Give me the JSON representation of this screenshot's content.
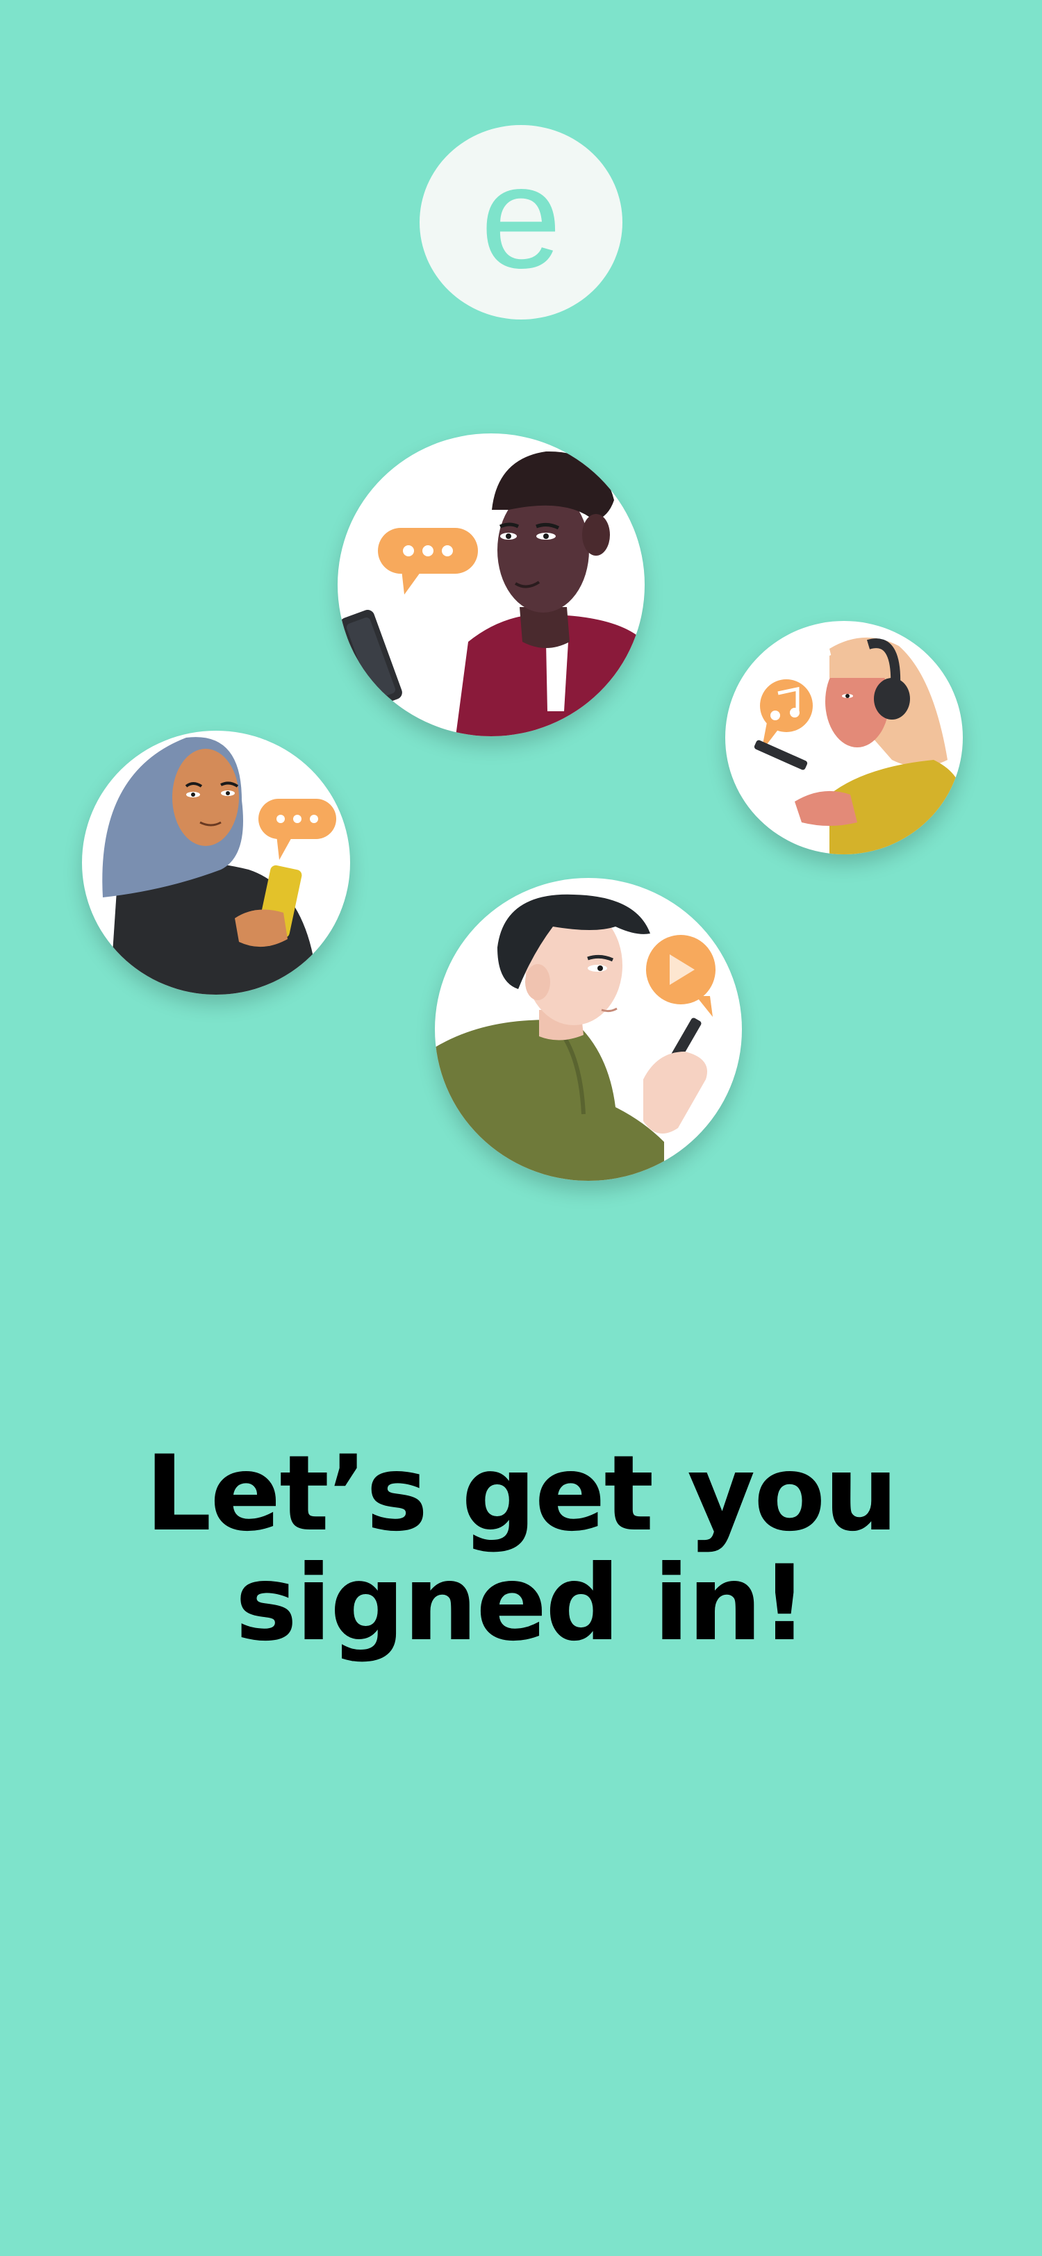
{
  "app": {
    "logo_letter": "e"
  },
  "headline": {
    "line1": "Let’s get you",
    "line2": "signed in!"
  },
  "illustrations": [
    {
      "name": "man-with-phone-chat",
      "icon": "chat-dots-icon"
    },
    {
      "name": "woman-headphones-music",
      "icon": "music-note-icon"
    },
    {
      "name": "woman-hijab-phone-chat",
      "icon": "chat-dots-icon"
    },
    {
      "name": "man-phone-video",
      "icon": "play-icon"
    }
  ],
  "colors": {
    "background": "#7EE3CB",
    "accent_orange": "#F7A95C",
    "logo_circle": "#F2F8F5"
  }
}
